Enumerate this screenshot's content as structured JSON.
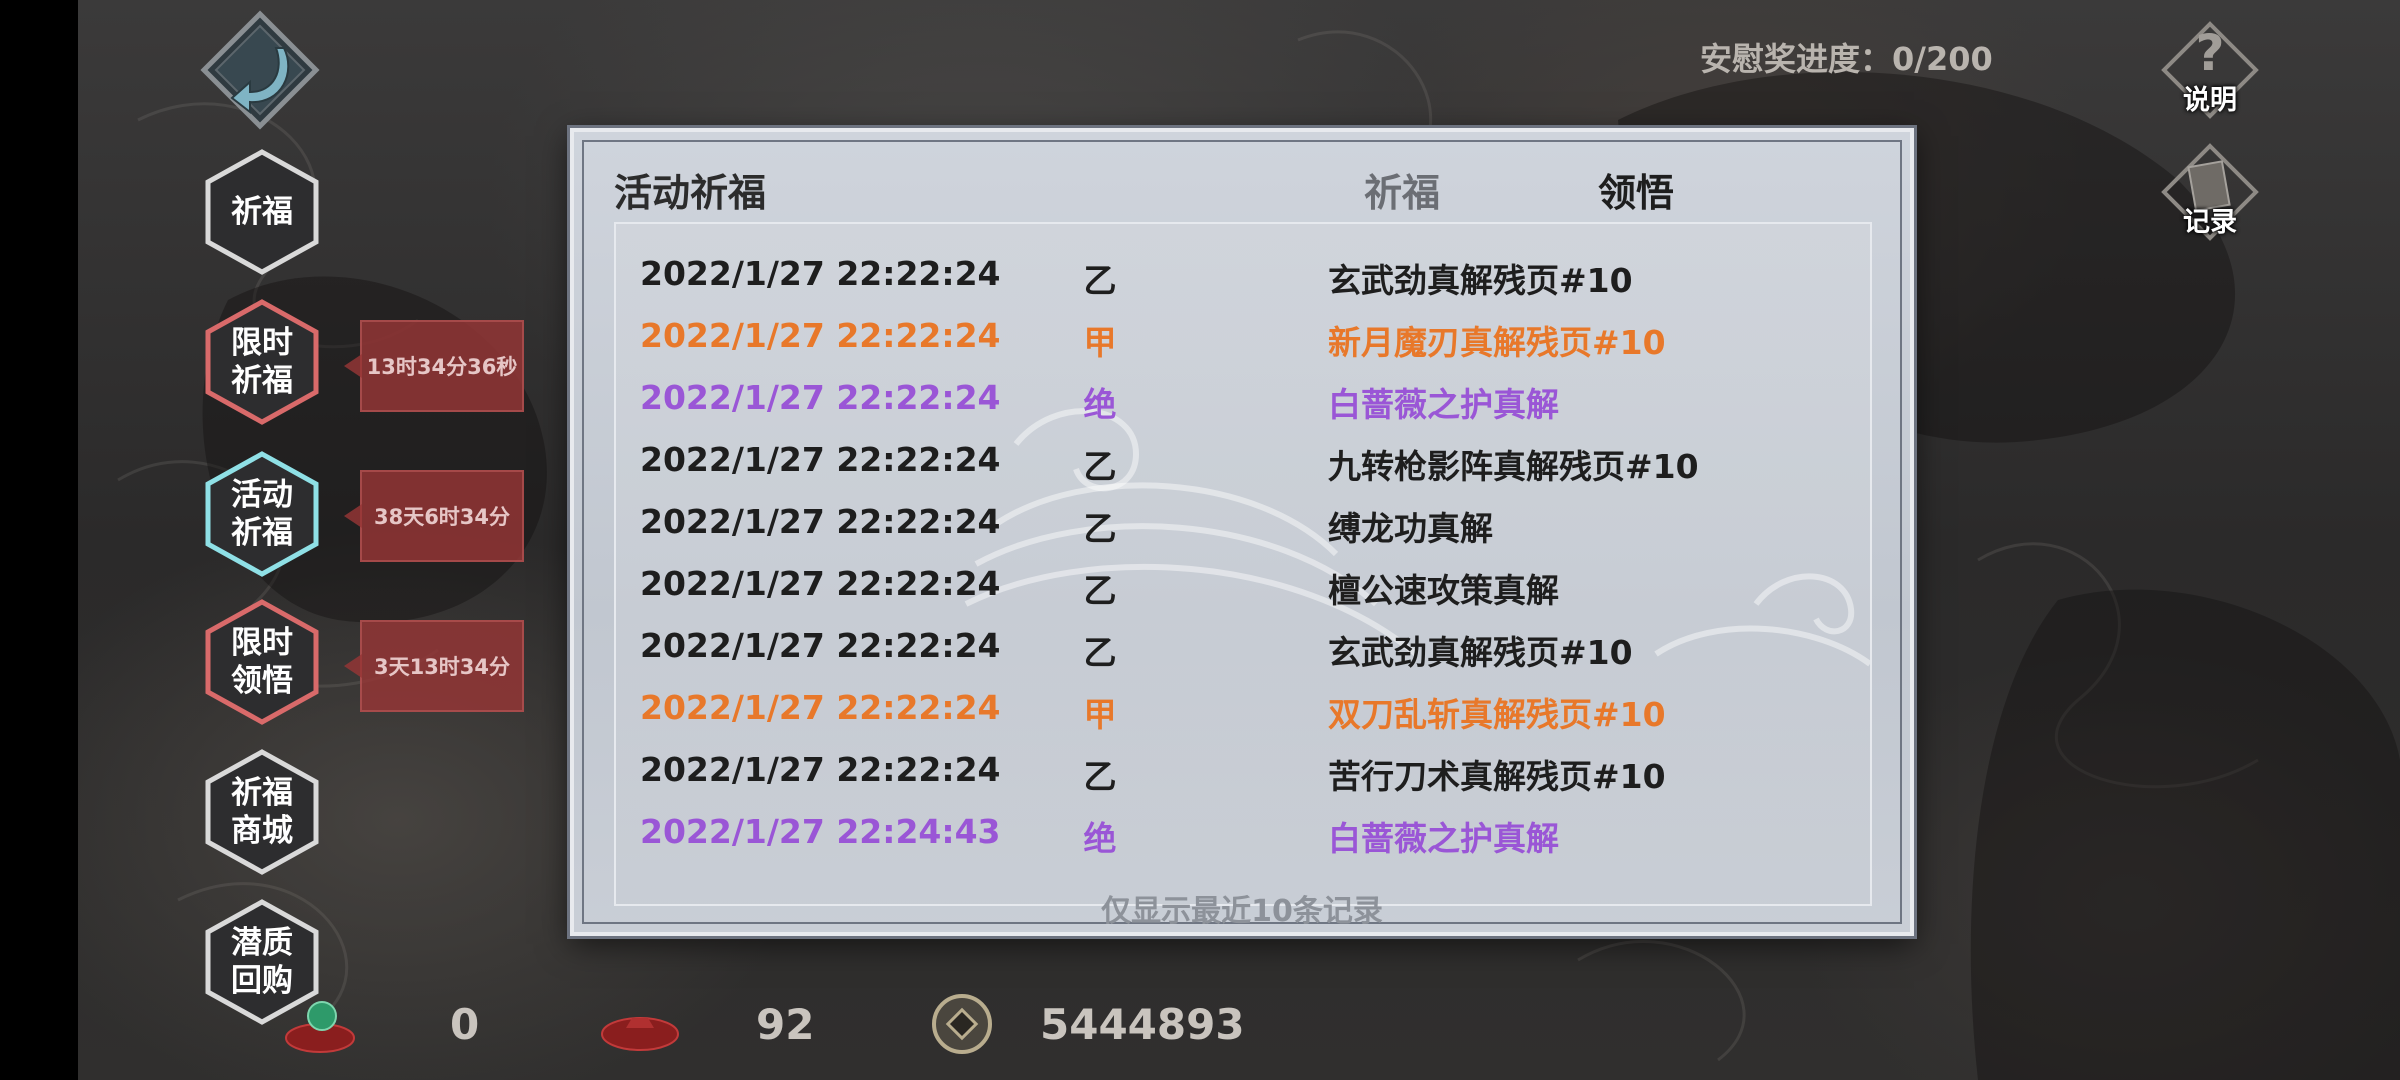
{
  "header": {
    "progress_label": "安慰奖进度：0/200",
    "help_label": "说明",
    "record_label": "记录"
  },
  "nav": {
    "items": [
      {
        "label": "祈福",
        "state": "normal"
      },
      {
        "label": "限时\n祈福",
        "state": "red",
        "timer": "13时34分36秒"
      },
      {
        "label": "活动\n祈福",
        "state": "selected",
        "timer": "38天6时34分"
      },
      {
        "label": "限时\n领悟",
        "state": "red",
        "timer": "3天13时34分"
      },
      {
        "label": "祈福\n商城",
        "state": "normal"
      },
      {
        "label": "潜质\n回购",
        "state": "normal"
      }
    ]
  },
  "panel": {
    "title": "活动祈福",
    "tab_pray": "祈福",
    "tab_comprehend": "领悟",
    "footer_note": "仅显示最近10条记录",
    "records": [
      {
        "time": "2022/1/27 22:22:24",
        "grade": "乙",
        "item": "玄武劲真解残页#10",
        "rarity": "normal"
      },
      {
        "time": "2022/1/27 22:22:24",
        "grade": "甲",
        "item": "新月魔刃真解残页#10",
        "rarity": "orange"
      },
      {
        "time": "2022/1/27 22:22:24",
        "grade": "绝",
        "item": "白蔷薇之护真解",
        "rarity": "purple"
      },
      {
        "time": "2022/1/27 22:22:24",
        "grade": "乙",
        "item": "九转枪影阵真解残页#10",
        "rarity": "normal"
      },
      {
        "time": "2022/1/27 22:22:24",
        "grade": "乙",
        "item": "缚龙功真解",
        "rarity": "normal"
      },
      {
        "time": "2022/1/27 22:22:24",
        "grade": "乙",
        "item": "檀公速攻策真解",
        "rarity": "normal"
      },
      {
        "time": "2022/1/27 22:22:24",
        "grade": "乙",
        "item": "玄武劲真解残页#10",
        "rarity": "normal"
      },
      {
        "time": "2022/1/27 22:22:24",
        "grade": "甲",
        "item": "双刀乱斩真解残页#10",
        "rarity": "orange"
      },
      {
        "time": "2022/1/27 22:22:24",
        "grade": "乙",
        "item": "苦行刀术真解残页#10",
        "rarity": "normal"
      },
      {
        "time": "2022/1/27 22:24:43",
        "grade": "绝",
        "item": "白蔷薇之护真解",
        "rarity": "purple"
      }
    ]
  },
  "currency": {
    "jade_amount": "0",
    "token_amount": "92",
    "coin_amount": "5444893"
  },
  "colors": {
    "normal": "#1e1e1e",
    "orange": "#e8782a",
    "purple": "#9a56d6",
    "tab_inactive": "#6b6e74",
    "tab_active": "#1e1e1e"
  }
}
